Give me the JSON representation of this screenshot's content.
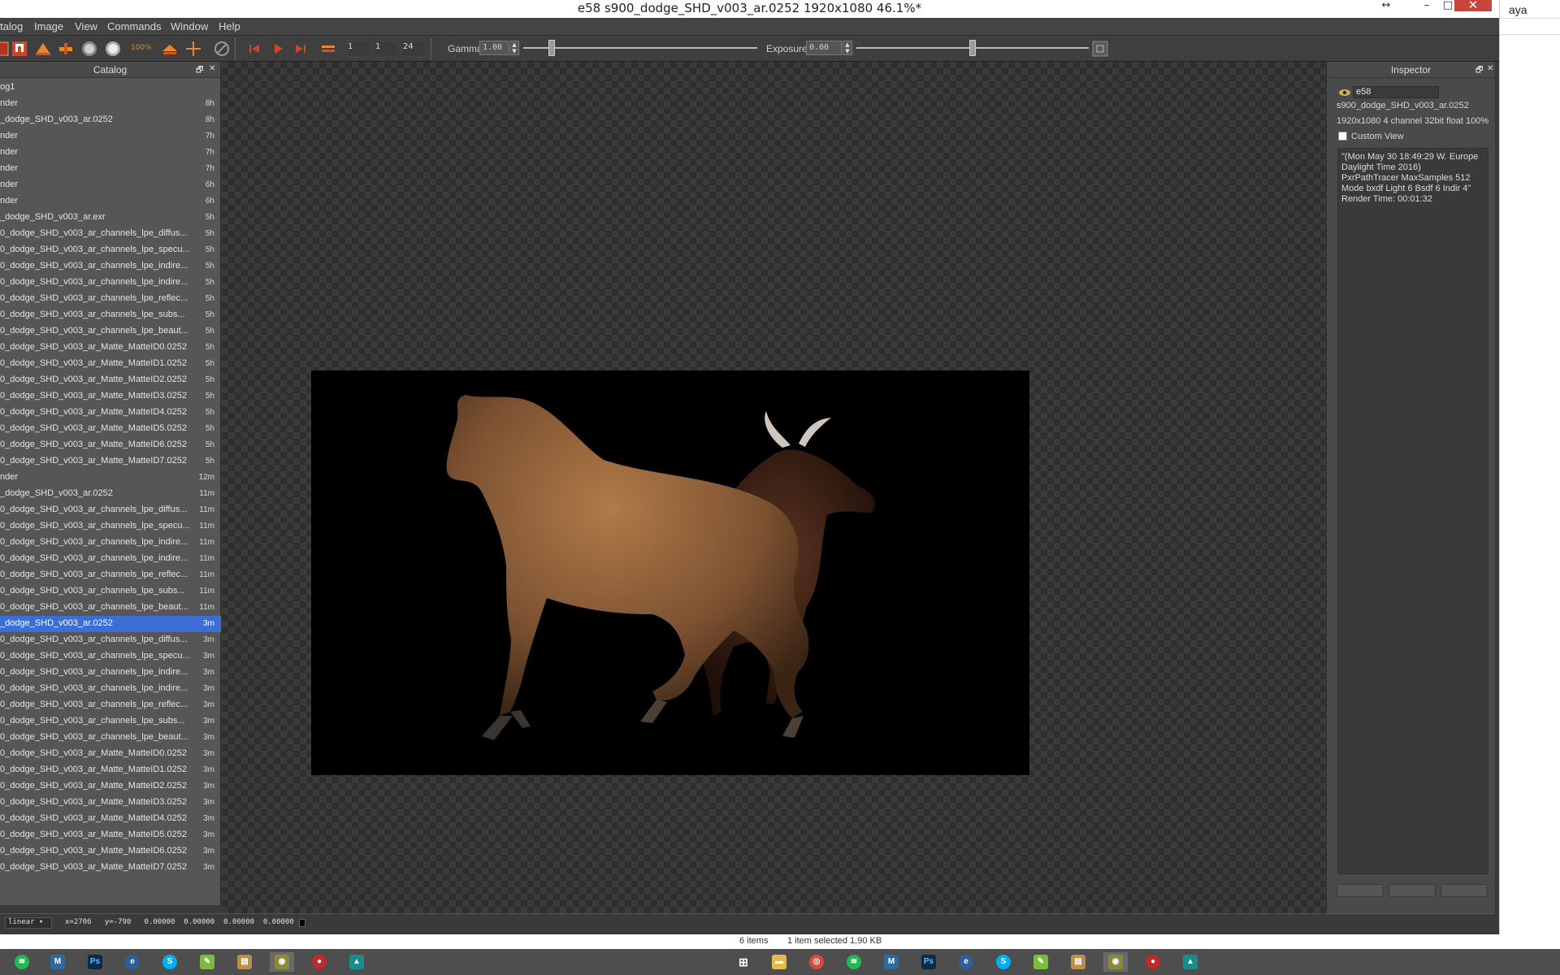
{
  "window": {
    "title": "e58 s900_dodge_SHD_v003_ar.0252 1920x1080 46.1%*",
    "resize_glyph": "↔",
    "minimize_glyph": "–",
    "maximize_glyph": "□",
    "close_glyph": "✕"
  },
  "background_window": {
    "title_fragment": "aya"
  },
  "menu": {
    "items": [
      "talog",
      "Image",
      "View",
      "Commands",
      "Window",
      "Help"
    ]
  },
  "toolbar": {
    "zoom_label": "100%",
    "frame_start": "1",
    "frame_current": "1",
    "frame_end": "24",
    "gamma_label": "Gamma",
    "gamma_value": "1.00",
    "gamma_level": 0.12,
    "exposure_label": "Exposure",
    "exposure_value": "0.00",
    "exposure_level": 0.5
  },
  "catalog": {
    "title": "Catalog",
    "float_glyph": "🗗",
    "close_glyph": "✕",
    "rows": [
      {
        "name": "og1",
        "age": ""
      },
      {
        "name": "nder",
        "age": "8h"
      },
      {
        "name": "_dodge_SHD_v003_ar.0252",
        "age": "8h"
      },
      {
        "name": "nder",
        "age": "7h"
      },
      {
        "name": "nder",
        "age": "7h"
      },
      {
        "name": "nder",
        "age": "7h"
      },
      {
        "name": "nder",
        "age": "6h"
      },
      {
        "name": "nder",
        "age": "6h"
      },
      {
        "name": "_dodge_SHD_v003_ar.exr",
        "age": "5h"
      },
      {
        "name": "0_dodge_SHD_v003_ar_channels_lpe_diffus...",
        "age": "5h"
      },
      {
        "name": "0_dodge_SHD_v003_ar_channels_lpe_specu...",
        "age": "5h"
      },
      {
        "name": "0_dodge_SHD_v003_ar_channels_lpe_indire...",
        "age": "5h"
      },
      {
        "name": "0_dodge_SHD_v003_ar_channels_lpe_indire...",
        "age": "5h"
      },
      {
        "name": "0_dodge_SHD_v003_ar_channels_lpe_reflec...",
        "age": "5h"
      },
      {
        "name": "0_dodge_SHD_v003_ar_channels_lpe_subs...",
        "age": "5h"
      },
      {
        "name": "0_dodge_SHD_v003_ar_channels_lpe_beaut...",
        "age": "5h"
      },
      {
        "name": "0_dodge_SHD_v003_ar_Matte_MatteID0.0252",
        "age": "5h"
      },
      {
        "name": "0_dodge_SHD_v003_ar_Matte_MatteID1.0252",
        "age": "5h"
      },
      {
        "name": "0_dodge_SHD_v003_ar_Matte_MatteID2.0252",
        "age": "5h"
      },
      {
        "name": "0_dodge_SHD_v003_ar_Matte_MatteID3.0252",
        "age": "5h"
      },
      {
        "name": "0_dodge_SHD_v003_ar_Matte_MatteID4.0252",
        "age": "5h"
      },
      {
        "name": "0_dodge_SHD_v003_ar_Matte_MatteID5.0252",
        "age": "5h"
      },
      {
        "name": "0_dodge_SHD_v003_ar_Matte_MatteID6.0252",
        "age": "5h"
      },
      {
        "name": "0_dodge_SHD_v003_ar_Matte_MatteID7.0252",
        "age": "5h"
      },
      {
        "name": "nder",
        "age": "12m"
      },
      {
        "name": "_dodge_SHD_v003_ar.0252",
        "age": "11m"
      },
      {
        "name": "0_dodge_SHD_v003_ar_channels_lpe_diffus...",
        "age": "11m"
      },
      {
        "name": "0_dodge_SHD_v003_ar_channels_lpe_specu...",
        "age": "11m"
      },
      {
        "name": "0_dodge_SHD_v003_ar_channels_lpe_indire...",
        "age": "11m"
      },
      {
        "name": "0_dodge_SHD_v003_ar_channels_lpe_indire...",
        "age": "11m"
      },
      {
        "name": "0_dodge_SHD_v003_ar_channels_lpe_reflec...",
        "age": "11m"
      },
      {
        "name": "0_dodge_SHD_v003_ar_channels_lpe_subs...",
        "age": "11m"
      },
      {
        "name": "0_dodge_SHD_v003_ar_channels_lpe_beaut...",
        "age": "11m"
      },
      {
        "name": "_dodge_SHD_v003_ar.0252",
        "age": "3m",
        "selected": true
      },
      {
        "name": "0_dodge_SHD_v003_ar_channels_lpe_diffus...",
        "age": "3m"
      },
      {
        "name": "0_dodge_SHD_v003_ar_channels_lpe_specu...",
        "age": "3m"
      },
      {
        "name": "0_dodge_SHD_v003_ar_channels_lpe_indire...",
        "age": "3m"
      },
      {
        "name": "0_dodge_SHD_v003_ar_channels_lpe_indire...",
        "age": "3m"
      },
      {
        "name": "0_dodge_SHD_v003_ar_channels_lpe_reflec...",
        "age": "3m"
      },
      {
        "name": "0_dodge_SHD_v003_ar_channels_lpe_subs...",
        "age": "3m"
      },
      {
        "name": "0_dodge_SHD_v003_ar_channels_lpe_beaut...",
        "age": "3m"
      },
      {
        "name": "0_dodge_SHD_v003_ar_Matte_MatteID0.0252",
        "age": "3m"
      },
      {
        "name": "0_dodge_SHD_v003_ar_Matte_MatteID1.0252",
        "age": "3m"
      },
      {
        "name": "0_dodge_SHD_v003_ar_Matte_MatteID2.0252",
        "age": "3m"
      },
      {
        "name": "0_dodge_SHD_v003_ar_Matte_MatteID3.0252",
        "age": "3m"
      },
      {
        "name": "0_dodge_SHD_v003_ar_Matte_MatteID4.0252",
        "age": "3m"
      },
      {
        "name": "0_dodge_SHD_v003_ar_Matte_MatteID5.0252",
        "age": "3m"
      },
      {
        "name": "0_dodge_SHD_v003_ar_Matte_MatteID6.0252",
        "age": "3m"
      },
      {
        "name": "0_dodge_SHD_v003_ar_Matte_MatteID7.0252",
        "age": "3m"
      }
    ]
  },
  "inspector": {
    "title": "Inspector",
    "float_glyph": "🗗",
    "close_glyph": "✕",
    "image_name": "e58",
    "filename": "s900_dodge_SHD_v003_ar.0252",
    "info": "1920x1080 4 channel 32bit float 100%",
    "custom_view_label": "Custom View",
    "notes": [
      "\"(Mon May 30 18:49:29 W. Europe",
      "Daylight Time 2016)",
      "PxrPathTracer  MaxSamples 512",
      "Mode bxdf  Light 6  Bsdf 6  Indir 4\"",
      "Render Time: 00:01:32"
    ]
  },
  "statusbar": {
    "colorspace": "linear",
    "pixel_readout": "x=2706   y=-790   0.00000  0.00000  0.00000  0.00000"
  },
  "explorer_status": {
    "items_count": "6 items",
    "selection": "1 item selected  1,90 KB"
  },
  "colors": {
    "selection": "#3b6fd6",
    "close_button": "#c7453b",
    "render_background": "#000000",
    "horse_body": "#8a5a34",
    "bull_body": "#3e2216"
  }
}
